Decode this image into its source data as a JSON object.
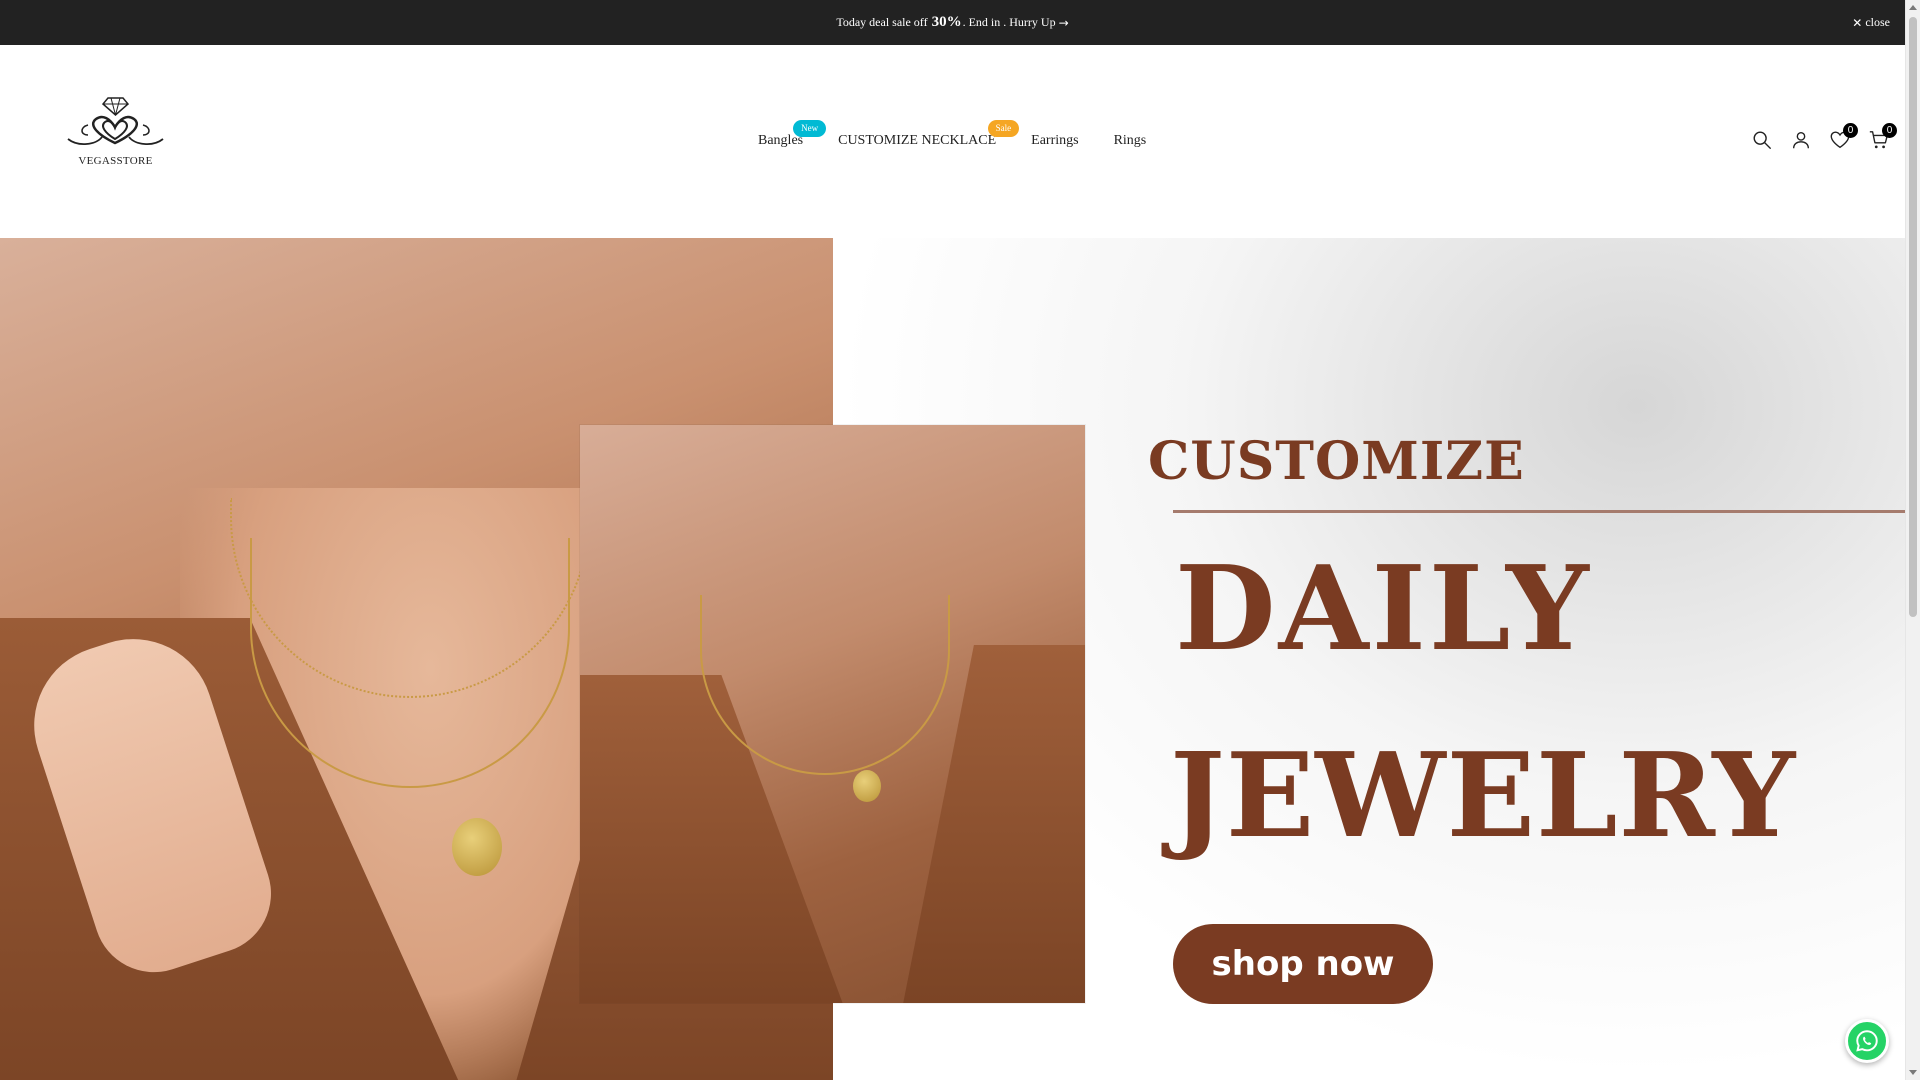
{
  "announcement": {
    "text_before": "Today deal sale off",
    "percent": "30%",
    "text_after": ". End in . Hurry Up",
    "arrow_icon": "arrow-right-icon",
    "close_label": "close"
  },
  "header": {
    "logo_text": "VEGASSTORE",
    "nav": [
      {
        "label": "Bangles",
        "badge": "New",
        "badge_color": "#01bad4"
      },
      {
        "label": "CUSTOMIZE NECKLACE",
        "badge": "Sale",
        "badge_color": "#f5a623"
      },
      {
        "label": "Earrings"
      },
      {
        "label": "Rings"
      }
    ],
    "wishlist_count": "0",
    "cart_count": "0",
    "icons": [
      "search-icon",
      "account-icon",
      "wishlist-icon",
      "cart-icon"
    ]
  },
  "hero": {
    "title": "CUSTOMIZE",
    "line1": "DAILY",
    "line2": "JEWELRY",
    "button_label": "shop now",
    "accent_color": "#7a3b22"
  },
  "floating": {
    "whatsapp_icon": "whatsapp-icon"
  }
}
